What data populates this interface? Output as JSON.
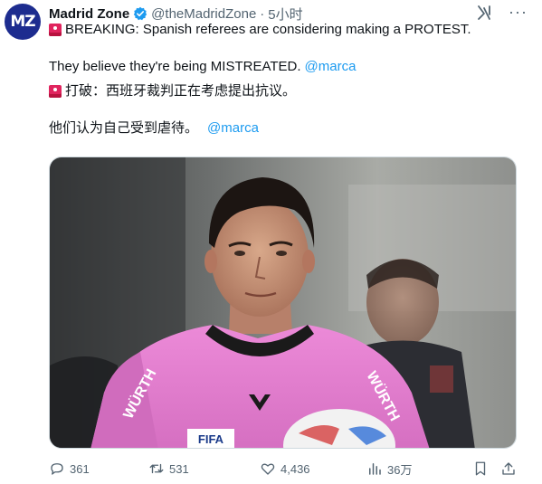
{
  "author": {
    "avatar_text": "MZ",
    "display_name": "Madrid Zone",
    "handle": "@theMadridZone",
    "separator": "·",
    "timestamp": "5小时"
  },
  "tweet": {
    "line1": "BREAKING: Spanish referees are considering making a PROTEST.",
    "line2_text": "They believe they're being MISTREATED.",
    "line2_mention": "@marca",
    "line3": "打破：西班牙裁判正在考虑提出抗议。",
    "line4_text": "他们认为自己受到虐待。",
    "line4_mention": "@marca"
  },
  "media": {
    "jersey_text_fifa": "FIFA",
    "jersey_text_sponsor": "WÜRTH",
    "jersey_colors": {
      "pink": "#e77fd2",
      "collar": "#1a1a1a"
    }
  },
  "actions": {
    "replies": "361",
    "retweets": "531",
    "likes": "4,436",
    "views": "36万"
  },
  "colors": {
    "accent": "#1d9bf0",
    "muted": "#536471",
    "siren": "#e0245e"
  }
}
